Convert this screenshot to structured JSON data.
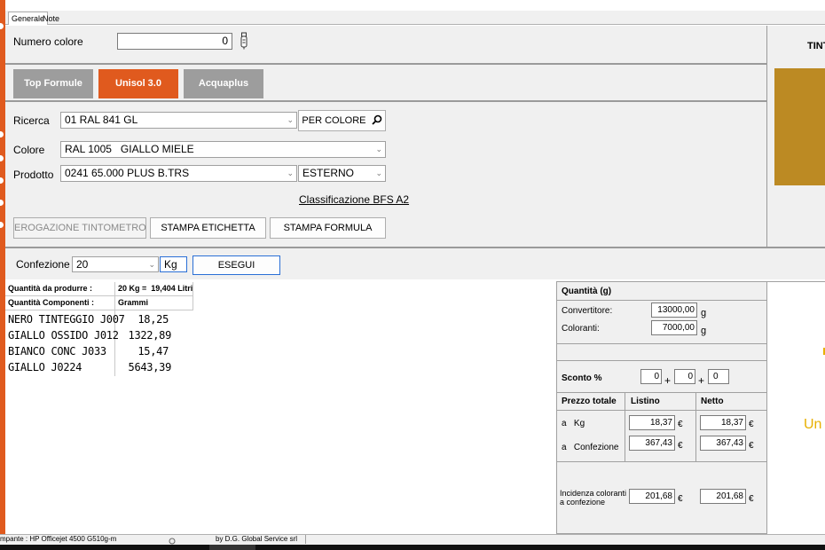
{
  "colors": {
    "orange": "#e05a1e",
    "gray_tab": "#9d9d9d",
    "swatch": "#bc8a23",
    "accent_text": "#e8b000"
  },
  "tabs": {
    "general": "Generale",
    "notes": "Note"
  },
  "numero": {
    "label": "Numero colore",
    "value": "0"
  },
  "systems": [
    {
      "label": "Top Formule"
    },
    {
      "label": "Unisol 3.0"
    },
    {
      "label": "Acquaplus"
    }
  ],
  "search": {
    "ricerca_label": "Ricerca",
    "ricerca_value": "01 RAL 841 GL",
    "per_colore_label": "PER COLORE"
  },
  "colore": {
    "label": "Colore",
    "value": "RAL 1005   GIALLO MIELE"
  },
  "prodotto": {
    "label": "Prodotto",
    "value": "0241 65.000 PLUS B.TRS",
    "uso_value": "ESTERNO"
  },
  "classificazione": "Classificazione BFS A2",
  "actions": {
    "erogazione": "EROGAZIONE TINTOMETRO",
    "etichetta": "STAMPA ETICHETTA",
    "formula": "STAMPA FORMULA"
  },
  "confezione": {
    "label": "Confezione",
    "value": "20",
    "unit": "Kg",
    "esegui": "ESEGUI"
  },
  "right_header": "TINT",
  "right_partial": "Un",
  "production": {
    "qty_label": "Quantità da produrre :",
    "qty_value": "20 Kg =  19,404 Litri",
    "comp_label": "Quantità Componenti :",
    "comp_unit": "Grammi",
    "components": [
      {
        "name": "NERO TINTEGGIO J007",
        "grams": "18,25"
      },
      {
        "name": "GIALLO OSSIDO J012",
        "grams": "1322,89"
      },
      {
        "name": "BIANCO CONC J033",
        "grams": "15,47"
      },
      {
        "name": "GIALLO J0224",
        "grams": "5643,39"
      }
    ]
  },
  "quantities": {
    "header": "Quantità (g)",
    "convertitore_label": "Convertitore:",
    "convertitore_value": "13000,00",
    "coloranti_label": "Coloranti:",
    "coloranti_value": "7000,00",
    "unit": "g"
  },
  "sconto": {
    "label": "Sconto %",
    "v1": "0",
    "v2": "0",
    "v3": "0",
    "plus": "+"
  },
  "prezzo": {
    "header": "Prezzo totale",
    "listino": "Listino",
    "netto": "Netto",
    "kg_label": "a   Kg",
    "kg_listino": "18,37",
    "kg_netto": "18,37",
    "conf_label": "a   Confezione",
    "conf_listino": "367,43",
    "conf_netto": "367,43",
    "currency": "€"
  },
  "incidenza": {
    "label1": "Incidenza coloranti",
    "label2": "a confezione",
    "listino": "201,68",
    "netto": "201,68"
  },
  "status": {
    "printer": "mpante : HP Officejet 4500 G510g-m",
    "credit": "by D.G. Global Service srl"
  }
}
